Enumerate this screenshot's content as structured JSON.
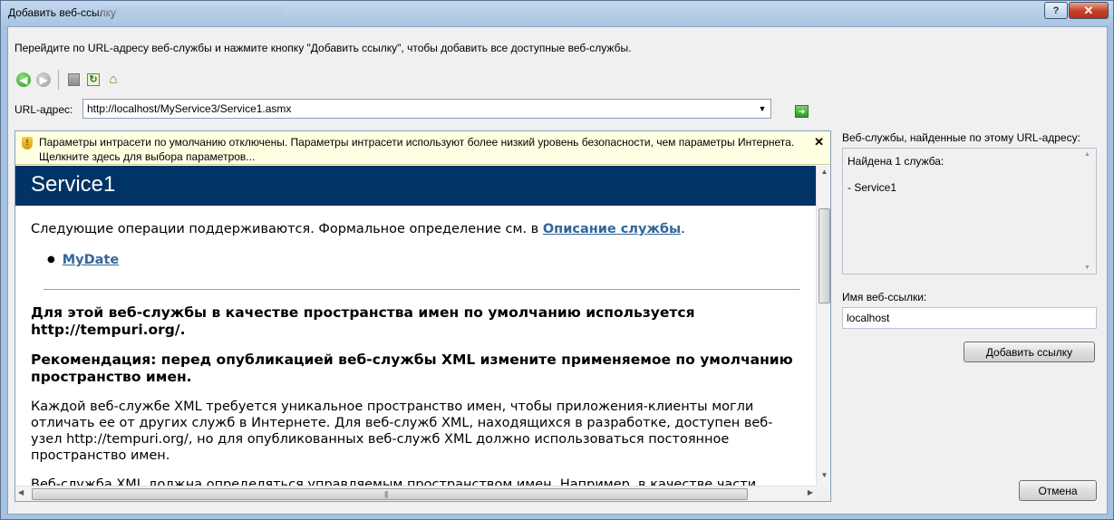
{
  "window": {
    "title": "Добавить веб-ссылку",
    "close_glyph": "✕",
    "help_glyph": "?"
  },
  "instruction": "Перейдите по URL-адресу веб-службы и нажмите кнопку \"Добавить ссылку\", чтобы добавить все доступные веб-службы.",
  "toolbar": {
    "back_icon": "back-arrow-icon",
    "forward_icon": "forward-arrow-icon",
    "stop_icon": "stop-icon",
    "refresh_icon": "refresh-icon",
    "home_icon": "home-icon"
  },
  "url": {
    "label": "URL-адрес:",
    "value": "http://localhost/MyService3/Service1.asmx"
  },
  "infobar": {
    "text": "Параметры интрасети по умолчанию отключены. Параметры интрасети используют более низкий уровень безопасности, чем параметры Интернета. Щелкните здесь для выбора параметров...",
    "close": "✕"
  },
  "page": {
    "banner": "Service1",
    "lead_prefix": "Следующие операции поддерживаются. Формальное определение см. в ",
    "lead_link": "Описание службы",
    "lead_suffix": ".",
    "operations": [
      "MyDate"
    ],
    "h_namespace": "Для этой веб-службы в качестве пространства имен по умолчанию используется http://tempuri.org/.",
    "h_recommend": "Рекомендация: перед опубликацией веб-службы XML измените применяемое по умолчанию пространство имен.",
    "p1": "Каждой веб-службе XML требуется уникальное пространство имен, чтобы приложения-клиенты могли отличать ее от других служб в Интернете. Для веб-служб XML, находящихся в разработке, доступен веб-узел http://tempuri.org/, но для опубликованных веб-служб XML должно использоваться постоянное пространство имен.",
    "p2": "Веб-служба XML должна определяться управляемым пространством имен. Например, в качестве части"
  },
  "side": {
    "found_label": "Веб-службы, найденные по этому URL-адресу:",
    "found_line1": "Найдена 1 служба:",
    "found_line2": "- Service1",
    "name_label": "Имя веб-ссылки:",
    "name_value": "localhost",
    "add_button": "Добавить ссылку",
    "cancel_button": "Отмена"
  },
  "colors": {
    "banner_bg": "#003366",
    "link": "#336699",
    "infobar_bg": "#ffffe1"
  }
}
